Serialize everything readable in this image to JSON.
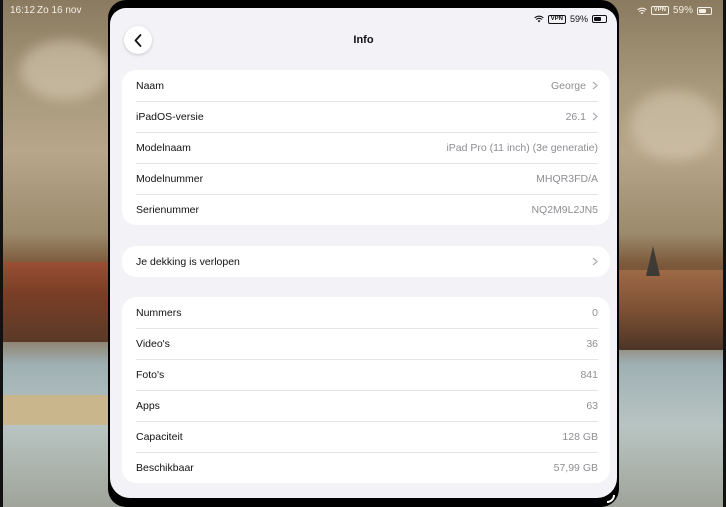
{
  "outer_status": {
    "time": "16:12",
    "date": "Zo 16 nov",
    "vpn": "VPN",
    "battery": "59%"
  },
  "status": {
    "vpn": "VPN",
    "battery": "59%"
  },
  "nav": {
    "title": "Info"
  },
  "device_info": [
    {
      "label": "Naam",
      "value": "George",
      "chevron": true
    },
    {
      "label": "iPadOS-versie",
      "value": "26.1",
      "chevron": true
    },
    {
      "label": "Modelnaam",
      "value": "iPad Pro (11 inch) (3e generatie)",
      "chevron": false
    },
    {
      "label": "Modelnummer",
      "value": "MHQR3FD/A",
      "chevron": false
    },
    {
      "label": "Serienummer",
      "value": "NQ2M9L2JN5",
      "chevron": false
    }
  ],
  "coverage": {
    "label": "Je dekking is verlopen"
  },
  "media": [
    {
      "label": "Nummers",
      "value": "0"
    },
    {
      "label": "Video's",
      "value": "36"
    },
    {
      "label": "Foto's",
      "value": "841"
    },
    {
      "label": "Apps",
      "value": "63"
    },
    {
      "label": "Capaciteit",
      "value": "128 GB"
    },
    {
      "label": "Beschikbaar",
      "value": "57,99 GB"
    }
  ]
}
